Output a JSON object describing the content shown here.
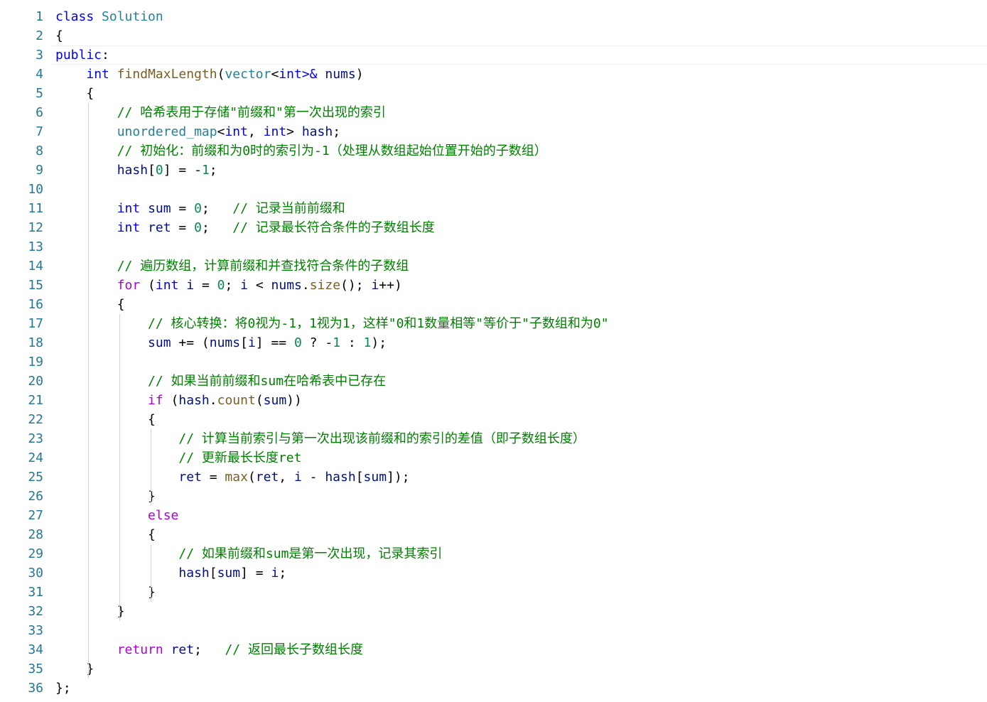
{
  "editor": {
    "language": "cpp",
    "current_line": 3,
    "colors": {
      "background": "#ffffff",
      "line_number": "#237893",
      "keyword": "#0000ff",
      "control": "#af00db",
      "type": "#267f99",
      "function": "#795e26",
      "variable": "#001080",
      "number": "#098658",
      "comment": "#008000"
    },
    "lines": [
      {
        "n": "1",
        "tokens": [
          [
            "kw",
            "class"
          ],
          [
            "",
            " "
          ],
          [
            "type",
            "Solution"
          ]
        ]
      },
      {
        "n": "2",
        "tokens": [
          [
            "",
            "{"
          ]
        ]
      },
      {
        "n": "3",
        "tokens": [
          [
            "kw",
            "public"
          ],
          [
            "",
            ":"
          ]
        ]
      },
      {
        "n": "4",
        "tokens": [
          [
            "",
            "    "
          ],
          [
            "kw",
            "int"
          ],
          [
            "",
            " "
          ],
          [
            "fn",
            "findMaxLength"
          ],
          [
            "",
            "("
          ],
          [
            "type",
            "vector"
          ],
          [
            "",
            "<"
          ],
          [
            "kw",
            "int"
          ],
          [
            "kw",
            ">&"
          ],
          [
            "",
            " "
          ],
          [
            "var",
            "nums"
          ],
          [
            "",
            ")"
          ]
        ]
      },
      {
        "n": "5",
        "tokens": [
          [
            "",
            "    {"
          ]
        ]
      },
      {
        "n": "6",
        "tokens": [
          [
            "",
            "        "
          ],
          [
            "cm",
            "// 哈希表用于存储\"前缀和\"第一次出现的索引"
          ]
        ]
      },
      {
        "n": "7",
        "tokens": [
          [
            "",
            "        "
          ],
          [
            "type",
            "unordered_map"
          ],
          [
            "",
            "<"
          ],
          [
            "kw",
            "int"
          ],
          [
            "",
            ", "
          ],
          [
            "kw",
            "int"
          ],
          [
            "",
            "> "
          ],
          [
            "var",
            "hash"
          ],
          [
            "",
            ";"
          ]
        ]
      },
      {
        "n": "8",
        "tokens": [
          [
            "",
            "        "
          ],
          [
            "cm",
            "// 初始化：前缀和为0时的索引为-1（处理从数组起始位置开始的子数组）"
          ]
        ]
      },
      {
        "n": "9",
        "tokens": [
          [
            "",
            "        "
          ],
          [
            "var",
            "hash"
          ],
          [
            "",
            "["
          ],
          [
            "num",
            "0"
          ],
          [
            "",
            "] = -"
          ],
          [
            "num",
            "1"
          ],
          [
            "",
            ";"
          ]
        ]
      },
      {
        "n": "10",
        "tokens": []
      },
      {
        "n": "11",
        "tokens": [
          [
            "",
            "        "
          ],
          [
            "kw",
            "int"
          ],
          [
            "",
            " "
          ],
          [
            "var",
            "sum"
          ],
          [
            "",
            " = "
          ],
          [
            "num",
            "0"
          ],
          [
            "",
            ";   "
          ],
          [
            "cm",
            "// 记录当前前缀和"
          ]
        ]
      },
      {
        "n": "12",
        "tokens": [
          [
            "",
            "        "
          ],
          [
            "kw",
            "int"
          ],
          [
            "",
            " "
          ],
          [
            "var",
            "ret"
          ],
          [
            "",
            " = "
          ],
          [
            "num",
            "0"
          ],
          [
            "",
            ";   "
          ],
          [
            "cm",
            "// 记录最长符合条件的子数组长度"
          ]
        ]
      },
      {
        "n": "13",
        "tokens": []
      },
      {
        "n": "14",
        "tokens": [
          [
            "",
            "        "
          ],
          [
            "cm",
            "// 遍历数组，计算前缀和并查找符合条件的子数组"
          ]
        ]
      },
      {
        "n": "15",
        "tokens": [
          [
            "",
            "        "
          ],
          [
            "ctrl",
            "for"
          ],
          [
            "",
            " ("
          ],
          [
            "kw",
            "int"
          ],
          [
            "",
            " "
          ],
          [
            "var",
            "i"
          ],
          [
            "",
            ""
          ],
          [
            "",
            " = "
          ],
          [
            "num",
            "0"
          ],
          [
            "",
            "; "
          ],
          [
            "var",
            "i"
          ],
          [
            "",
            " < "
          ],
          [
            "var",
            "nums"
          ],
          [
            "",
            "."
          ],
          [
            "fn",
            "size"
          ],
          [
            "",
            "(); "
          ],
          [
            "var",
            "i"
          ],
          [
            "",
            "++)"
          ]
        ]
      },
      {
        "n": "16",
        "tokens": [
          [
            "",
            "        {"
          ]
        ]
      },
      {
        "n": "17",
        "tokens": [
          [
            "",
            "            "
          ],
          [
            "cm",
            "// 核心转换：将0视为-1，1视为1，这样\"0和1数量相等\"等价于\"子数组和为0\""
          ]
        ]
      },
      {
        "n": "18",
        "tokens": [
          [
            "",
            "            "
          ],
          [
            "var",
            "sum"
          ],
          [
            "",
            " += ("
          ],
          [
            "var",
            "nums"
          ],
          [
            "",
            "["
          ],
          [
            "var",
            "i"
          ],
          [
            "",
            "] == "
          ],
          [
            "num",
            "0"
          ],
          [
            "",
            " ? -"
          ],
          [
            "num",
            "1"
          ],
          [
            "",
            " : "
          ],
          [
            "num",
            "1"
          ],
          [
            "",
            ");"
          ]
        ]
      },
      {
        "n": "19",
        "tokens": []
      },
      {
        "n": "20",
        "tokens": [
          [
            "",
            "            "
          ],
          [
            "cm",
            "// 如果当前前缀和sum在哈希表中已存在"
          ]
        ]
      },
      {
        "n": "21",
        "tokens": [
          [
            "",
            "            "
          ],
          [
            "ctrl",
            "if"
          ],
          [
            "",
            " ("
          ],
          [
            "var",
            "hash"
          ],
          [
            "",
            "."
          ],
          [
            "fn",
            "count"
          ],
          [
            "",
            "("
          ],
          [
            "var",
            "sum"
          ],
          [
            "",
            "))"
          ]
        ]
      },
      {
        "n": "22",
        "tokens": [
          [
            "",
            "            {"
          ]
        ]
      },
      {
        "n": "23",
        "tokens": [
          [
            "",
            "                "
          ],
          [
            "cm",
            "// 计算当前索引与第一次出现该前缀和的索引的差值（即子数组长度）"
          ]
        ]
      },
      {
        "n": "24",
        "tokens": [
          [
            "",
            "                "
          ],
          [
            "cm",
            "// 更新最长长度ret"
          ]
        ]
      },
      {
        "n": "25",
        "tokens": [
          [
            "",
            "                "
          ],
          [
            "var",
            "ret"
          ],
          [
            "",
            " = "
          ],
          [
            "fn",
            "max"
          ],
          [
            "",
            "("
          ],
          [
            "var",
            "ret"
          ],
          [
            "",
            ", "
          ],
          [
            "var",
            "i"
          ],
          [
            "",
            " - "
          ],
          [
            "var",
            "hash"
          ],
          [
            "",
            "["
          ],
          [
            "var",
            "sum"
          ],
          [
            "",
            "]);"
          ]
        ]
      },
      {
        "n": "26",
        "tokens": [
          [
            "",
            "            }"
          ]
        ]
      },
      {
        "n": "27",
        "tokens": [
          [
            "",
            "            "
          ],
          [
            "ctrl",
            "else"
          ]
        ]
      },
      {
        "n": "28",
        "tokens": [
          [
            "",
            "            {"
          ]
        ]
      },
      {
        "n": "29",
        "tokens": [
          [
            "",
            "                "
          ],
          [
            "cm",
            "// 如果前缀和sum是第一次出现，记录其索引"
          ]
        ]
      },
      {
        "n": "30",
        "tokens": [
          [
            "",
            "                "
          ],
          [
            "var",
            "hash"
          ],
          [
            "",
            "["
          ],
          [
            "var",
            "sum"
          ],
          [
            "",
            "] = "
          ],
          [
            "var",
            "i"
          ],
          [
            "",
            ";"
          ]
        ]
      },
      {
        "n": "31",
        "tokens": [
          [
            "",
            "            }"
          ]
        ]
      },
      {
        "n": "32",
        "tokens": [
          [
            "",
            "        }"
          ]
        ]
      },
      {
        "n": "33",
        "tokens": []
      },
      {
        "n": "34",
        "tokens": [
          [
            "",
            "        "
          ],
          [
            "ctrl",
            "return"
          ],
          [
            "",
            " "
          ],
          [
            "var",
            "ret"
          ],
          [
            "",
            ";   "
          ],
          [
            "cm",
            "// 返回最长子数组长度"
          ]
        ]
      },
      {
        "n": "35",
        "tokens": [
          [
            "",
            "    }"
          ]
        ]
      },
      {
        "n": "36",
        "tokens": [
          [
            "",
            "};"
          ]
        ]
      }
    ]
  }
}
